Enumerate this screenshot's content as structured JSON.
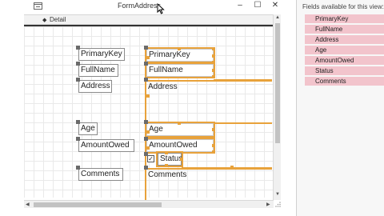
{
  "window": {
    "title": "FormAddress",
    "minimize": "–",
    "maximize": "☐",
    "close": "✕"
  },
  "section": {
    "arrow": "◆",
    "label": "Detail"
  },
  "labels": {
    "primary_key": "PrimaryKey",
    "full_name": "FullName",
    "address": "Address",
    "age": "Age",
    "amount_owed": "AmountOwed",
    "comments": "Comments"
  },
  "fields": {
    "primary_key": "PrimaryKey",
    "full_name": "FullName",
    "address": "Address",
    "age": "Age",
    "amount_owed": "AmountOwed",
    "status": "Status",
    "comments": "Comments"
  },
  "status_checkbox": {
    "mark": "✓"
  },
  "scroll": {
    "up": "▲",
    "down": "▼",
    "left": "◀",
    "right": "▶"
  },
  "field_list": {
    "heading": "Fields available for this view:",
    "items": [
      "PrimaryKey",
      "FullName",
      "Address",
      "Age",
      "AmountOwed",
      "Status",
      "Comments"
    ]
  },
  "colors": {
    "selection": "#e8a23b",
    "field_item_bg": "#f2c4cc"
  }
}
